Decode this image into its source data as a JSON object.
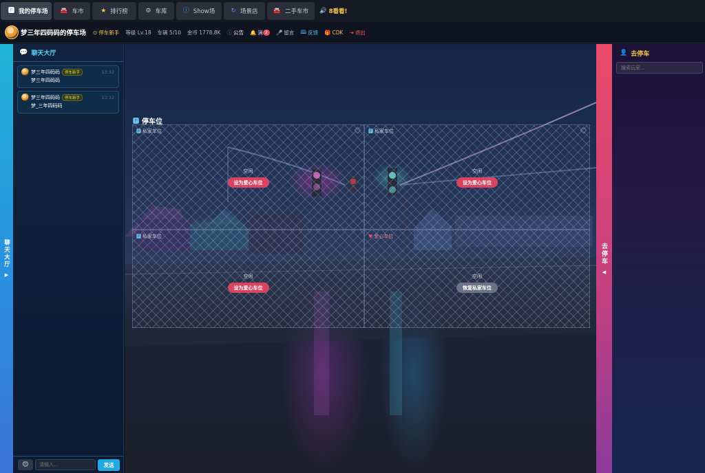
{
  "nav": {
    "tabs": [
      {
        "label": "我的停车场",
        "icon": "parking-icon"
      },
      {
        "label": "车市",
        "icon": "car-icon"
      },
      {
        "label": "排行榜",
        "icon": "star-icon"
      },
      {
        "label": "车库",
        "icon": "gear-icon"
      },
      {
        "label": "Show场",
        "icon": "info-icon"
      },
      {
        "label": "场景店",
        "icon": "refresh-icon"
      },
      {
        "label": "二手车市",
        "icon": "car-icon"
      }
    ],
    "promo_label": "8看看!",
    "accent_color": "#f5c64a"
  },
  "user": {
    "name": "梦三年四码码的停车场",
    "rank": "停车新手",
    "level": "等级 Lv.18",
    "cars": "车辆 5/10",
    "coins": "金币 1778.8K",
    "notice": "公告",
    "messages": "消",
    "messages_badge": "2",
    "guestbook": "留言",
    "feedback": "反馈",
    "cdk": "CDK",
    "logout": "退出"
  },
  "chat": {
    "strip_label": "聊天大厅",
    "title": "聊天大厅",
    "messages": [
      {
        "name": "梦三年四码码",
        "tag": "停车新手",
        "time": "13:32",
        "text": "梦三年四码码"
      },
      {
        "name": "梦三年四码码",
        "tag": "停车新手",
        "time": "13:32",
        "text": "梦_三年四码码"
      }
    ],
    "input_placeholder": "请输入...",
    "send_label": "发送"
  },
  "parking": {
    "title": "停车位",
    "slots": [
      {
        "label": "私家车位",
        "type": "private",
        "status": "空闲",
        "action": "设为爱心车位"
      },
      {
        "label": "私家车位",
        "type": "private",
        "status": "空闲",
        "action": "设为爱心车位"
      },
      {
        "label": "私家车位",
        "type": "private",
        "status": "空闲",
        "action": "设为爱心车位"
      },
      {
        "label": "爱心车位",
        "type": "love",
        "status": "空闲",
        "action": "恢复私家车位"
      }
    ]
  },
  "park_panel": {
    "strip_label": "去停车",
    "title": "去停车",
    "search_placeholder": "搜索玩家..."
  }
}
